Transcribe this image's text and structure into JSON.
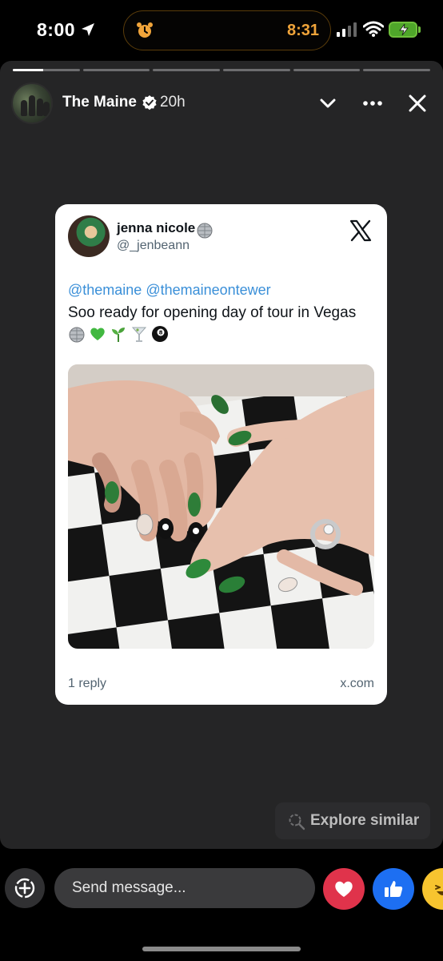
{
  "status_bar": {
    "time": "8:00",
    "alarm_time": "8:31",
    "accent_color": "#f0a43a"
  },
  "story": {
    "progress_segments": 6,
    "active_segment_progress": 0.45,
    "author": "The Maine",
    "verified": true,
    "posted_ago": "20h",
    "icons": {
      "collapse": "chevron-down-icon",
      "more": "more-icon",
      "close": "close-icon"
    }
  },
  "tweet": {
    "display_name": "jenna nicole",
    "handle": "@_jenbeann",
    "mentions": "@themaine @themaineontewer",
    "text": "Soo ready for opening day of tour in Vegas",
    "emojis": [
      "disco-ball",
      "green-heart",
      "seedling",
      "martini",
      "8-ball"
    ],
    "replies": "1 reply",
    "domain": "x.com",
    "brand_icon": "x-logo-icon",
    "photo_alt": "green manicured nails on a checkered tabletop"
  },
  "explore": {
    "label": "Explore similar"
  },
  "composer": {
    "placeholder": "Send message...",
    "reactions": [
      "heart",
      "thumbs-up",
      "haha"
    ],
    "colors": {
      "heart": "#e0334b",
      "like": "#1d6ff2",
      "haha": "#f7c42f"
    }
  }
}
